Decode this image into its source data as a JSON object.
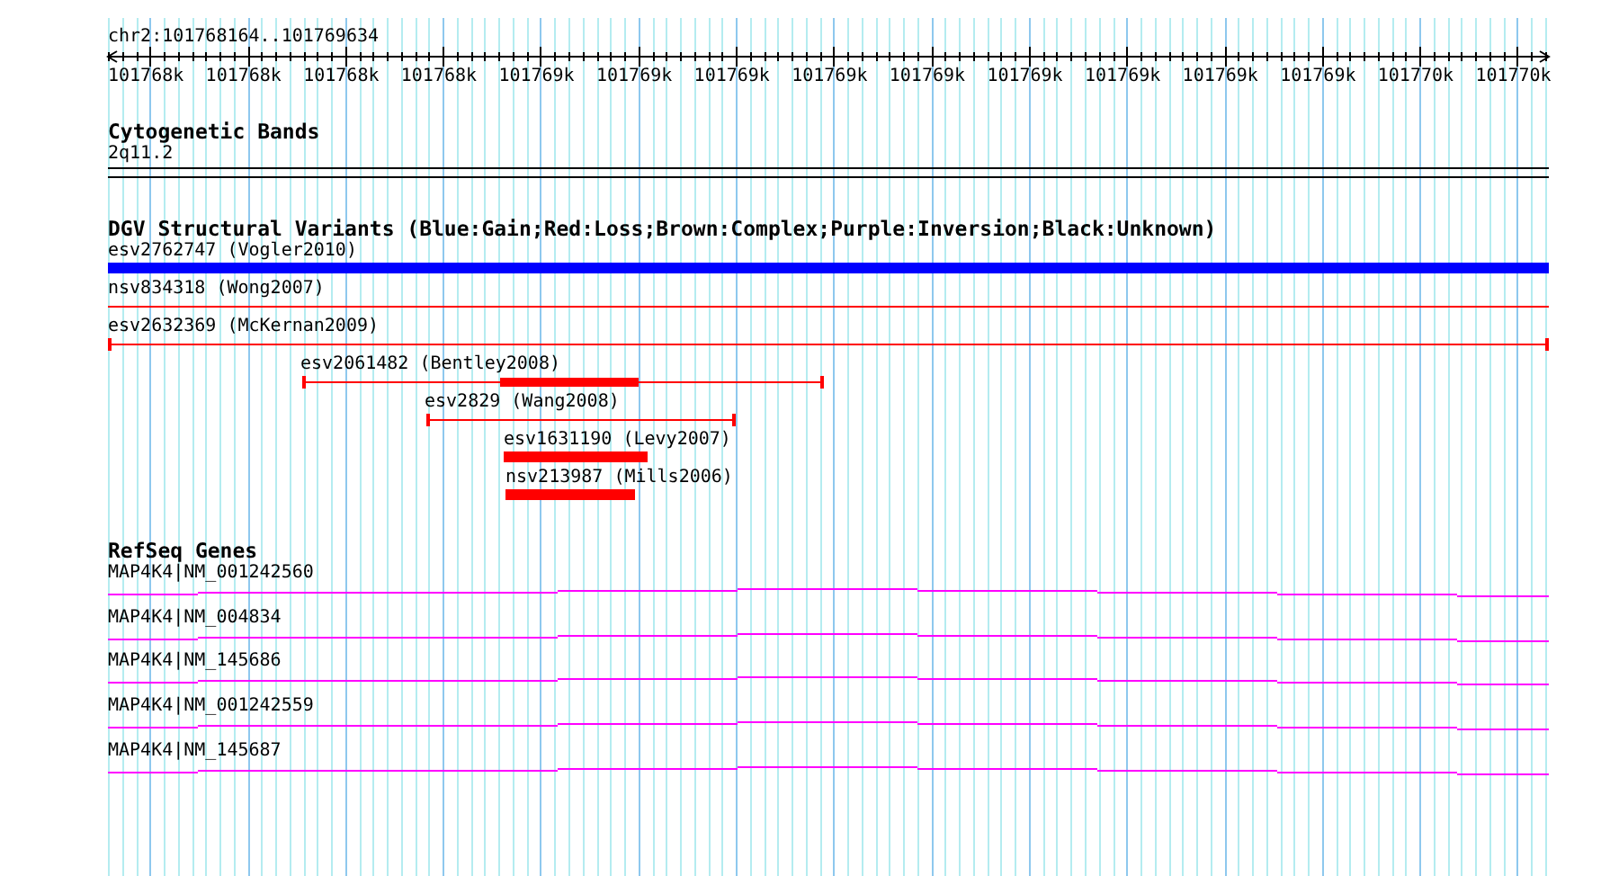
{
  "location": "chr2:101768164..101769634",
  "ruler": {
    "labels": [
      "101768k",
      "101768k",
      "101768k",
      "101768k",
      "101769k",
      "101769k",
      "101769k",
      "101769k",
      "101769k",
      "101769k",
      "101769k",
      "101769k",
      "101769k",
      "101770k",
      "101770k"
    ]
  },
  "tracks": [
    {
      "kind": "bands",
      "title": "Cytogenetic Bands",
      "band": "2q11.2"
    },
    {
      "kind": "variants",
      "title": "DGV Structural Variants (Blue:Gain;Red:Loss;Brown:Complex;Purple:Inversion;Black:Unknown)",
      "features": [
        {
          "label": "esv2762747 (Vogler2010)",
          "kind": "bar",
          "color": "#0000ff"
        },
        {
          "label": "nsv834318 (Wong2007)",
          "kind": "thin",
          "color": "#ff0000"
        },
        {
          "label": "esv2632369 (McKernan2009)",
          "kind": "capped",
          "color": "#ff0000"
        },
        {
          "label": "esv2061482 (Bentley2008)",
          "kind": "capped-core",
          "color": "#ff0000"
        },
        {
          "label": "esv2829 (Wang2008)",
          "kind": "capped",
          "color": "#ff0000"
        },
        {
          "label": "esv1631190 (Levy2007)",
          "kind": "bar",
          "color": "#ff0000"
        },
        {
          "label": "nsv213987 (Mills2006)",
          "kind": "bar",
          "color": "#ff0000"
        }
      ]
    },
    {
      "kind": "genes",
      "title": "RefSeq Genes",
      "genes": [
        {
          "label": "MAP4K4|NM_001242560"
        },
        {
          "label": "MAP4K4|NM_004834"
        },
        {
          "label": "MAP4K4|NM_145686"
        },
        {
          "label": "MAP4K4|NM_001242559"
        },
        {
          "label": "MAP4K4|NM_145687"
        }
      ]
    }
  ]
}
